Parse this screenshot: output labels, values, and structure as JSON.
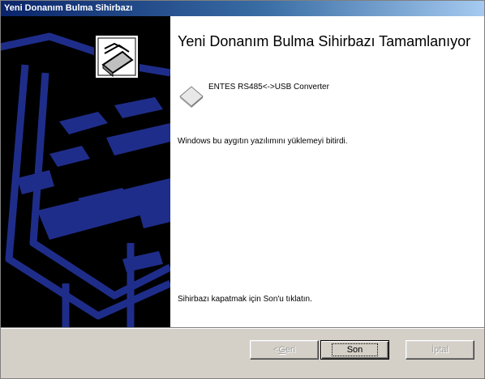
{
  "window": {
    "title": "Yeni Donanım Bulma Sihirbazı"
  },
  "content": {
    "heading": "Yeni Donanım Bulma Sihirbazı Tamamlanıyor",
    "device_name": "ENTES RS485<->USB Converter",
    "finished_message": "Windows bu aygıtın yazılımını yüklemeyi bitirdi.",
    "close_message": "Sihirbazı kapatmak için Son'u tıklatın."
  },
  "buttons": {
    "back_prefix": "< ",
    "back_mnemonic": "G",
    "back_rest": "eri",
    "finish": "Son",
    "cancel": "İptal"
  },
  "colors": {
    "sidebar_bg": "#000000",
    "sidebar_art": "#1f2d8a",
    "titlebar_start": "#0a246a",
    "titlebar_end": "#a6caf0"
  }
}
